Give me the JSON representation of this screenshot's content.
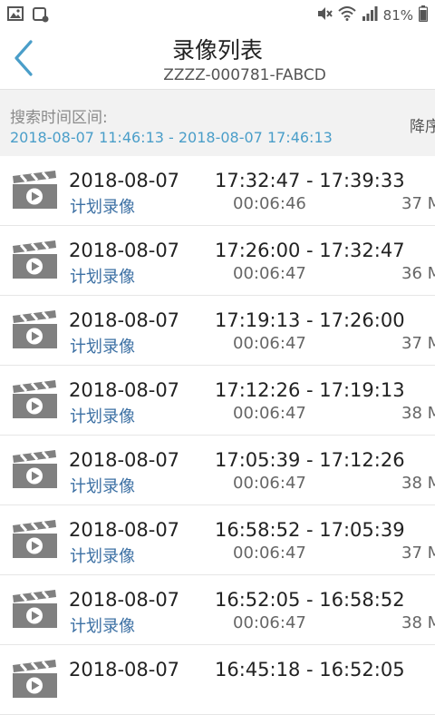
{
  "status_bar": {
    "left_icons": [
      "image-icon",
      "notification-icon"
    ],
    "battery": "81%",
    "right_icons": [
      "mute-icon",
      "wifi-icon",
      "signal-icon",
      "battery-icon"
    ]
  },
  "header": {
    "back_icon": "chevron-left-icon",
    "title": "录像列表",
    "subtitle": "ZZZZ-000781-FABCD"
  },
  "search": {
    "label": "搜索时间区间:",
    "range": "2018-08-07 11:46:13 - 2018-08-07 17:46:13",
    "sort_label": "降序"
  },
  "recordings": [
    {
      "date": "2018-08-07",
      "type": "计划录像",
      "time": "17:32:47 - 17:39:33",
      "duration": "00:06:46",
      "size": "37 M"
    },
    {
      "date": "2018-08-07",
      "type": "计划录像",
      "time": "17:26:00 - 17:32:47",
      "duration": "00:06:47",
      "size": "36 M"
    },
    {
      "date": "2018-08-07",
      "type": "计划录像",
      "time": "17:19:13 - 17:26:00",
      "duration": "00:06:47",
      "size": "37 M"
    },
    {
      "date": "2018-08-07",
      "type": "计划录像",
      "time": "17:12:26 - 17:19:13",
      "duration": "00:06:47",
      "size": "38 M"
    },
    {
      "date": "2018-08-07",
      "type": "计划录像",
      "time": "17:05:39 - 17:12:26",
      "duration": "00:06:47",
      "size": "38 M"
    },
    {
      "date": "2018-08-07",
      "type": "计划录像",
      "time": "16:58:52 - 17:05:39",
      "duration": "00:06:47",
      "size": "37 M"
    },
    {
      "date": "2018-08-07",
      "type": "计划录像",
      "time": "16:52:05 - 16:58:52",
      "duration": "00:06:47",
      "size": "38 M"
    },
    {
      "date": "2018-08-07",
      "type": "",
      "time": "16:45:18 - 16:52:05",
      "duration": "",
      "size": ""
    }
  ],
  "colors": {
    "accent": "#4a9ec9",
    "type_text": "#3b6fa3",
    "search_bg": "#f2f2f2",
    "icon_gray": "#808080"
  }
}
